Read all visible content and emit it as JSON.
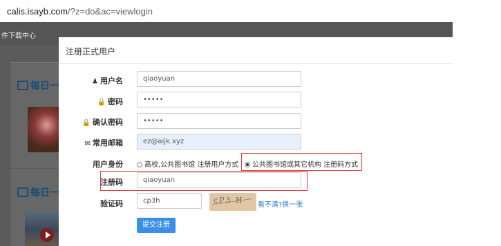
{
  "browser": {
    "url_host": "calis.isayb.com",
    "url_path": "/?z=do&ac=viewlogin"
  },
  "background_page": {
    "nav_text": "件下载中心",
    "card_title_1": "每日一",
    "card_title_2": "每日一"
  },
  "modal": {
    "title": "注册正式用户",
    "fields": {
      "username": {
        "label": "用户名",
        "value": "qiaoyuan"
      },
      "password": {
        "label": "密码",
        "value": "•••••"
      },
      "confirm_password": {
        "label": "确认密码",
        "value": "•••••"
      },
      "email": {
        "label": "常用邮箱",
        "value": "ez@aijk.xyz"
      }
    },
    "identity": {
      "label": "用户身份",
      "option_1": "高校,公共图书馆 注册用户方式",
      "option_2": "公共图书馆或其它机构 注册码方式",
      "selected": "option_2"
    },
    "reg_code": {
      "label": "注册码",
      "value": "qiaoyuan"
    },
    "captcha": {
      "label": "验证码",
      "value": "cp3h",
      "image_text": "cP3 H",
      "refresh_link": "看不清?换一张"
    },
    "submit_label": "提交注册"
  },
  "colors": {
    "overlay": "#5b5b5b",
    "accent": "#3a8ee6",
    "highlight_red": "#e23a3a",
    "autofill": "#e8f0fe"
  }
}
